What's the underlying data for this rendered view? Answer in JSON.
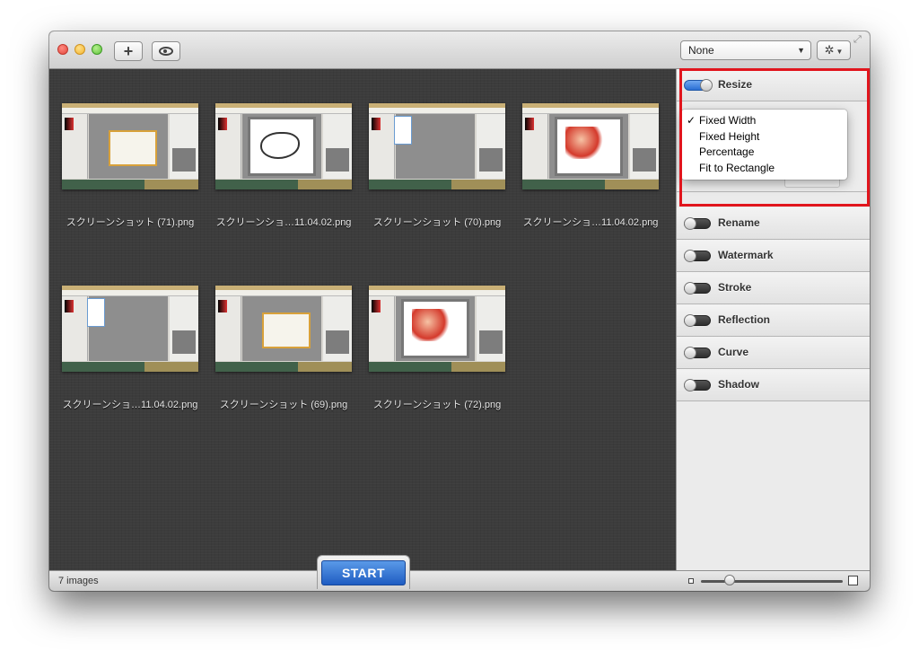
{
  "toolbar": {
    "add_icon": "plus-icon",
    "preview_icon": "eye-icon",
    "preset_value": "None",
    "gear_icon": "gear-icon"
  },
  "thumbnails": [
    {
      "caption": "スクリーンショット (71).png",
      "variant": "dialog"
    },
    {
      "caption": "スクリーンショ…11.04.02.png",
      "variant": "sketch"
    },
    {
      "caption": "スクリーンショット (70).png",
      "variant": "menu"
    },
    {
      "caption": "スクリーンショ…11.04.02.png",
      "variant": "color"
    },
    {
      "caption": "スクリーンショ…11.04.02.png",
      "variant": "menu"
    },
    {
      "caption": "スクリーンショット (69).png",
      "variant": "dialog"
    },
    {
      "caption": "スクリーンショット (72).png",
      "variant": "color"
    }
  ],
  "sidebar": {
    "resize": {
      "label": "Resize",
      "enabled": true,
      "dropdown": {
        "selected": "Fixed Width",
        "check_mark": "✓",
        "options": [
          "Fixed Width",
          "Fixed Height",
          "Percentage",
          "Fit to Rectangle"
        ]
      }
    },
    "sections": [
      {
        "label": "Rename",
        "enabled": false
      },
      {
        "label": "Watermark",
        "enabled": false
      },
      {
        "label": "Stroke",
        "enabled": false
      },
      {
        "label": "Reflection",
        "enabled": false
      },
      {
        "label": "Curve",
        "enabled": false
      },
      {
        "label": "Shadow",
        "enabled": false
      }
    ]
  },
  "bottom": {
    "count": "7 images",
    "start_label": "START"
  },
  "colors": {
    "accent_blue": "#2a6fd4",
    "highlight_red": "#e1151d",
    "content_bg": "#3c3c3c"
  }
}
